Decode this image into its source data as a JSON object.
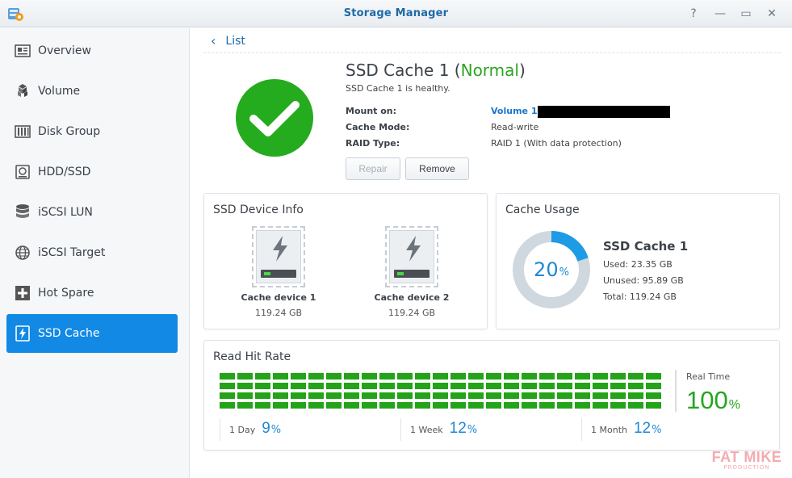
{
  "window": {
    "title": "Storage Manager",
    "controls": {
      "help": "?",
      "minimize": "—",
      "maximize": "▭",
      "close": "✕"
    }
  },
  "sidebar": {
    "items": [
      {
        "label": "Overview",
        "icon": "overview-icon",
        "active": false
      },
      {
        "label": "Volume",
        "icon": "volume-icon",
        "active": false
      },
      {
        "label": "Disk Group",
        "icon": "disk-group-icon",
        "active": false
      },
      {
        "label": "HDD/SSD",
        "icon": "hdd-icon",
        "active": false
      },
      {
        "label": "iSCSI LUN",
        "icon": "database-icon",
        "active": false
      },
      {
        "label": "iSCSI Target",
        "icon": "globe-icon",
        "active": false
      },
      {
        "label": "Hot Spare",
        "icon": "plus-box-icon",
        "active": false
      },
      {
        "label": "SSD Cache",
        "icon": "lightning-icon",
        "active": true
      }
    ]
  },
  "breadcrumb": {
    "label": "List"
  },
  "status": {
    "name": "SSD Cache 1",
    "state": "Normal",
    "subtitle": "SSD Cache 1 is healthy.",
    "color": "#25ab1e"
  },
  "info": {
    "mount_label": "Mount on:",
    "mount_value": "Volume 1",
    "mode_label": "Cache Mode:",
    "mode_value": "Read-write",
    "raid_label": "RAID Type:",
    "raid_value": "RAID 1 (With data protection)"
  },
  "actions": {
    "repair": "Repair",
    "remove": "Remove"
  },
  "device_info": {
    "title": "SSD Device Info",
    "devices": [
      {
        "name": "Cache device 1",
        "size": "119.24 GB"
      },
      {
        "name": "Cache device 2",
        "size": "119.24 GB"
      }
    ]
  },
  "cache_usage": {
    "title": "Cache Usage",
    "name": "SSD Cache 1",
    "percent": 20,
    "percent_unit": "%",
    "used": "Used: 23.35 GB",
    "unused": "Unused: 95.89 GB",
    "total": "Total: 119.24 GB",
    "accent_color": "#1e9be5",
    "track_color": "#cfd7df"
  },
  "read_hit_rate": {
    "title": "Read Hit Rate",
    "realtime_label": "Real Time",
    "realtime_value": "100",
    "realtime_unit": "%",
    "bar_fill": 1.0,
    "bar_color": "#22a318",
    "stats": [
      {
        "label": "1 Day",
        "value": "9",
        "unit": "%"
      },
      {
        "label": "1 Week",
        "value": "12",
        "unit": "%"
      },
      {
        "label": "1 Month",
        "value": "12",
        "unit": "%"
      }
    ]
  },
  "watermark": {
    "line1": "FAT MIKE",
    "line2": "PRODUCTION"
  }
}
